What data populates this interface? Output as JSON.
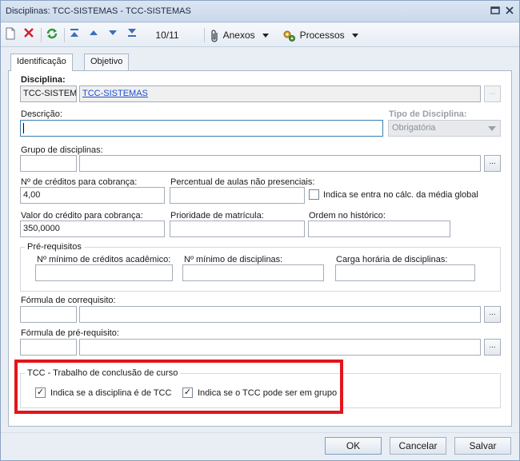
{
  "window": {
    "title": "Disciplinas: TCC-SISTEMAS - TCC-SISTEMAS"
  },
  "toolbar": {
    "record_counter": "10/11",
    "anexos_label": "Anexos",
    "processos_label": "Processos"
  },
  "tabs": [
    {
      "label": "Identificação",
      "active": true
    },
    {
      "label": "Objetivo",
      "active": false
    }
  ],
  "form": {
    "disciplina": {
      "label": "Disciplina:",
      "code": "TCC-SISTEM",
      "name": "TCC-SISTEMAS"
    },
    "descricao": {
      "label": "Descrição:",
      "value": ""
    },
    "tipo_disciplina": {
      "label": "Tipo de Disciplina:",
      "value": "Obrigatória"
    },
    "grupo": {
      "label": "Grupo de disciplinas:",
      "code": "",
      "name": ""
    },
    "creditos_cobranca": {
      "label": "Nº de créditos para cobrança:",
      "value": "4,00"
    },
    "percentual_aulas": {
      "label": "Percentual de aulas não presenciais:",
      "value": ""
    },
    "indica_media_global": {
      "label": "Indica se entra no cálc. da média global",
      "checked": false
    },
    "valor_credito": {
      "label": "Valor do crédito para cobrança:",
      "value": "350,0000"
    },
    "prioridade_matricula": {
      "label": "Prioridade de matrícula:",
      "value": ""
    },
    "ordem_historico": {
      "label": "Ordem no histórico:",
      "value": ""
    },
    "pre_requisitos": {
      "title": "Pré-requisitos",
      "min_creditos_label": "Nº mínimo de créditos acadêmico:",
      "min_disciplinas_label": "Nº mínimo de disciplinas:",
      "carga_horaria_label": "Carga horária de disciplinas:",
      "min_creditos": "",
      "min_disciplinas": "",
      "carga_horaria": ""
    },
    "formula_correquisito": {
      "label": "Fórmula de correquisito:",
      "code": "",
      "name": ""
    },
    "formula_pre_requisito": {
      "label": "Fórmula de pré-requisito:",
      "code": "",
      "name": ""
    },
    "tcc": {
      "title": "TCC - Trabalho de conclusão de curso",
      "indica_tcc": {
        "label": "Indica se a disciplina é de TCC",
        "checked": true
      },
      "indica_grupo": {
        "label": "Indica se o TCC pode ser em grupo",
        "checked": true
      }
    },
    "ellipsis": "..."
  },
  "footer": {
    "ok": "OK",
    "cancelar": "Cancelar",
    "salvar": "Salvar"
  },
  "check_mark": "✓",
  "colors": {
    "highlight": "#e3141b",
    "link": "#1a4fd0",
    "accent": "#3c7fb1"
  }
}
